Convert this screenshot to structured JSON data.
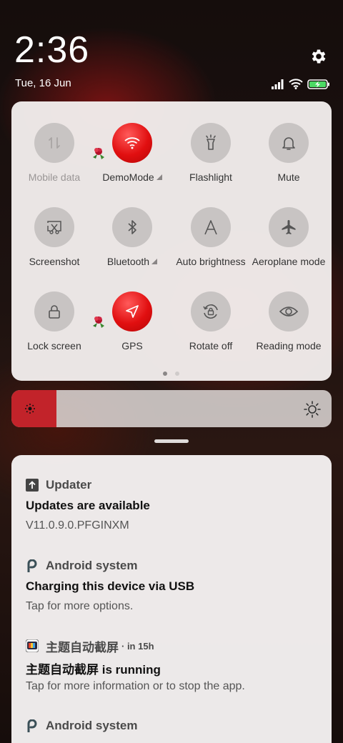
{
  "status": {
    "time": "2:36",
    "date": "Tue, 16 Jun"
  },
  "quick_settings": {
    "tiles": [
      {
        "label": "Mobile data",
        "icon": "mobile-data-icon",
        "active": false,
        "disabled": true
      },
      {
        "label": "DemoMode",
        "icon": "wifi-icon",
        "active": true,
        "expandable": true
      },
      {
        "label": "Flashlight",
        "icon": "flashlight-icon",
        "active": false
      },
      {
        "label": "Mute",
        "icon": "bell-icon",
        "active": false
      },
      {
        "label": "Screenshot",
        "icon": "screenshot-icon",
        "active": false
      },
      {
        "label": "Bluetooth",
        "icon": "bluetooth-icon",
        "active": false,
        "expandable": true
      },
      {
        "label": "Auto brightness",
        "icon": "auto-brightness-icon",
        "active": false
      },
      {
        "label": "Aeroplane mode",
        "icon": "airplane-icon",
        "active": false
      },
      {
        "label": "Lock screen",
        "icon": "lock-icon",
        "active": false
      },
      {
        "label": "GPS",
        "icon": "location-arrow-icon",
        "active": true
      },
      {
        "label": "Rotate off",
        "icon": "rotate-lock-icon",
        "active": false
      },
      {
        "label": "Reading mode",
        "icon": "eye-icon",
        "active": false
      }
    ],
    "page_index": 1,
    "page_count": 2,
    "accent_color": "#e10f10"
  },
  "brightness": {
    "level": 0.14,
    "color": "#c2232a"
  },
  "notifications": [
    {
      "app": "Updater",
      "time": "",
      "icon": "updater-arrow-icon",
      "title": "Updates are available",
      "text": "V11.0.9.0.PFGINXM"
    },
    {
      "app": "Android system",
      "time": "",
      "icon": "android-p-icon",
      "title": "Charging this device via USB",
      "text": "Tap for more options."
    },
    {
      "app": "主题自动截屏",
      "time": "· in 15h",
      "icon": "app-tv-icon",
      "title": "主题自动截屏 is running",
      "text": "Tap for more information or to stop the app."
    },
    {
      "app": "Android system",
      "time": "",
      "icon": "android-p-icon",
      "title": "",
      "text": ""
    }
  ]
}
